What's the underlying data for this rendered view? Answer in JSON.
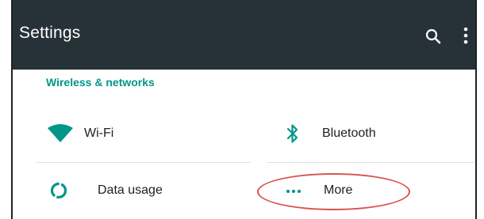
{
  "toolbar": {
    "title": "Settings",
    "search_icon": "search-icon",
    "overflow_icon": "more-vert-icon"
  },
  "section": {
    "title": "Wireless & networks"
  },
  "tiles": [
    {
      "label": "Wi-Fi",
      "icon": "wifi-icon"
    },
    {
      "label": "Bluetooth",
      "icon": "bluetooth-icon"
    },
    {
      "label": "Data usage",
      "icon": "data-usage-icon"
    },
    {
      "label": "More",
      "icon": "more-horiz-icon"
    }
  ],
  "colors": {
    "toolbar": "#263238",
    "accent": "#009688",
    "highlight_ring": "#d9534f",
    "text": "#212121"
  }
}
